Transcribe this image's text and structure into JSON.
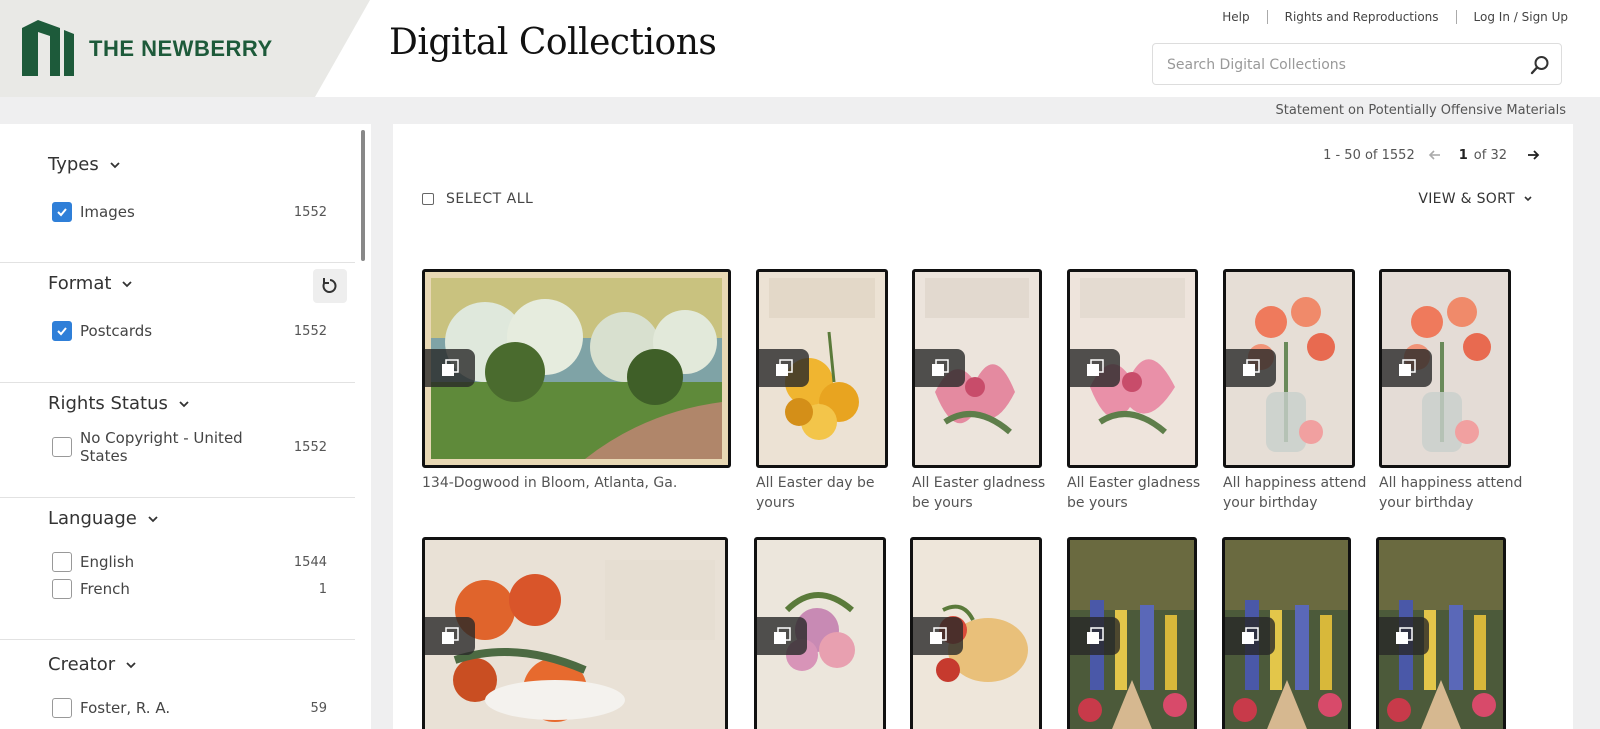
{
  "brand": {
    "name": "THE NEWBERRY",
    "colors": {
      "logo_green": "#1d5a3a",
      "checkbox_blue": "#2f7fd8"
    }
  },
  "header": {
    "title": "Digital Collections",
    "links": {
      "help": "Help",
      "rights": "Rights and Reproductions",
      "login": "Log In / Sign Up"
    },
    "search": {
      "placeholder": "Search Digital Collections",
      "icon": "search-icon"
    }
  },
  "statement": "Statement on Potentially Offensive Materials",
  "facets": {
    "types": {
      "title": "Types",
      "options": [
        {
          "label": "Images",
          "count": "1552",
          "checked": true
        }
      ]
    },
    "format": {
      "title": "Format",
      "options": [
        {
          "label": "Postcards",
          "count": "1552",
          "checked": true
        }
      ]
    },
    "rights": {
      "title": "Rights Status",
      "options": [
        {
          "label": "No Copyright - United States",
          "count": "1552",
          "checked": false
        }
      ]
    },
    "language": {
      "title": "Language",
      "options": [
        {
          "label": "English",
          "count": "1544",
          "checked": false
        },
        {
          "label": "French",
          "count": "1",
          "checked": false
        }
      ]
    },
    "creator": {
      "title": "Creator",
      "options": [
        {
          "label": "Foster, R. A.",
          "count": "59",
          "checked": false
        }
      ]
    }
  },
  "results": {
    "range": "1 - 50 of 1552",
    "page": "1",
    "page_total": "of 32",
    "select_all": "SELECT ALL",
    "view_sort": "VIEW & SORT",
    "items": [
      {
        "caption": "134-Dogwood in Bloom, Atlanta, Ga."
      },
      {
        "caption_line1": "All Easter day be",
        "caption_line2": "yours"
      },
      {
        "caption_line1": "All Easter gladness",
        "caption_line2": "be yours"
      },
      {
        "caption_line1": "All Easter gladness",
        "caption_line2": "be yours"
      },
      {
        "caption_line1": "All happiness attend",
        "caption_line2": "your birthday"
      },
      {
        "caption_line1": "All happiness attend",
        "caption_line2": "your birthday"
      }
    ]
  }
}
